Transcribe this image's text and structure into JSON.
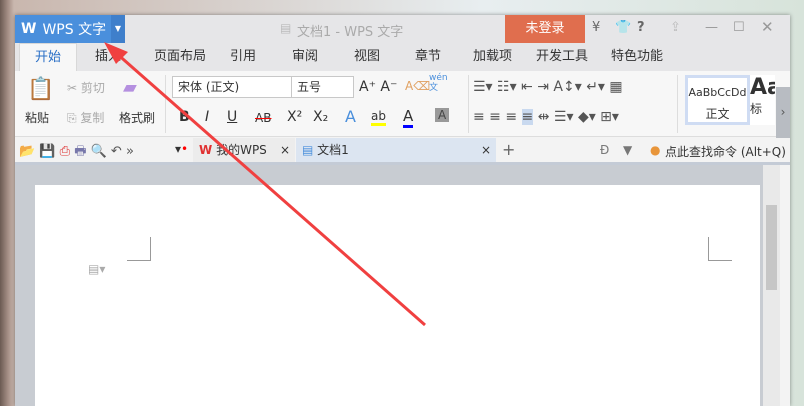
{
  "titlebar": {
    "app_button": "WPS 文字",
    "logo": "W",
    "doc_title": "文档1 - WPS 文字",
    "login": "未登录",
    "help": "?"
  },
  "tabs": [
    "开始",
    "插入",
    "页面布局",
    "引用",
    "审阅",
    "视图",
    "章节",
    "加载项",
    "开发工具",
    "特色功能"
  ],
  "ribbon": {
    "paste": "粘贴",
    "cut": "剪切",
    "copy": "复制",
    "format_painter": "格式刷",
    "font": "宋体 (正文)",
    "size": "五号",
    "pinyin": "wén",
    "pinyin_char": "文",
    "styles": [
      {
        "sample": "AaBbCcDd",
        "name": "正文"
      },
      {
        "sample": "Aa",
        "name": "标"
      }
    ],
    "bold": "B",
    "italic": "I",
    "underline": "U",
    "strike": "AB",
    "sup": "X²",
    "sub": "X₂"
  },
  "quickbar": {
    "doc_tabs": [
      "我的WPS",
      "文档1"
    ],
    "search": "点此查找命令 (Alt+Q)"
  },
  "colors": {
    "accent": "#4a8fdc",
    "login": "#e06e4e",
    "arrow": "#f04040"
  }
}
